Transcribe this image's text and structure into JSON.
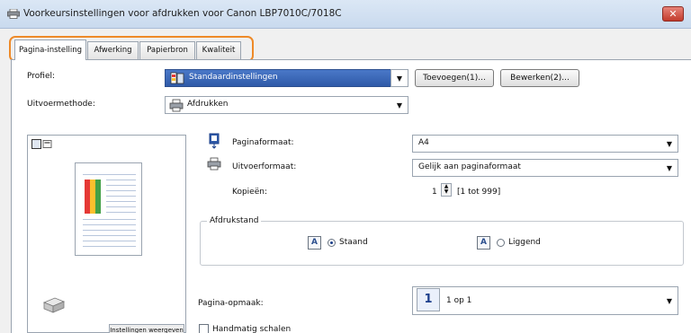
{
  "window": {
    "title": "Voorkeursinstellingen voor afdrukken voor Canon LBP7010C/7018C",
    "close_label": "✕"
  },
  "tabs": [
    {
      "label": "Pagina-instelling"
    },
    {
      "label": "Afwerking"
    },
    {
      "label": "Papierbron"
    },
    {
      "label": "Kwaliteit"
    }
  ],
  "profile": {
    "label": "Profiel:",
    "value": "Standaardinstellingen",
    "add_label": "Toevoegen(1)...",
    "edit_label": "Bewerken(2)..."
  },
  "output": {
    "label": "Uitvoermethode:",
    "value": "Afdrukken"
  },
  "page_size": {
    "label": "Paginaformaat:",
    "value": "A4"
  },
  "output_size": {
    "label": "Uitvoerformaat:",
    "value": "Gelijk aan paginaformaat"
  },
  "copies": {
    "label": "Kopieën:",
    "value": "1",
    "range": "[1 tot 999]"
  },
  "orientation": {
    "legend": "Afdrukstand",
    "portrait_label": "Staand",
    "landscape_label": "Liggend",
    "icon_letter": "A",
    "selected": "Staand"
  },
  "layout": {
    "label": "Pagina-opmaak:",
    "icon_number": "1",
    "value": "1 op 1"
  },
  "manual_scale": {
    "label": "Handmatig schalen"
  },
  "preview": {
    "button_label": "Instellingen weergeven"
  },
  "colors": {
    "tab_highlight": "#ee8a28",
    "profile_bg": "#2f5aa8"
  }
}
